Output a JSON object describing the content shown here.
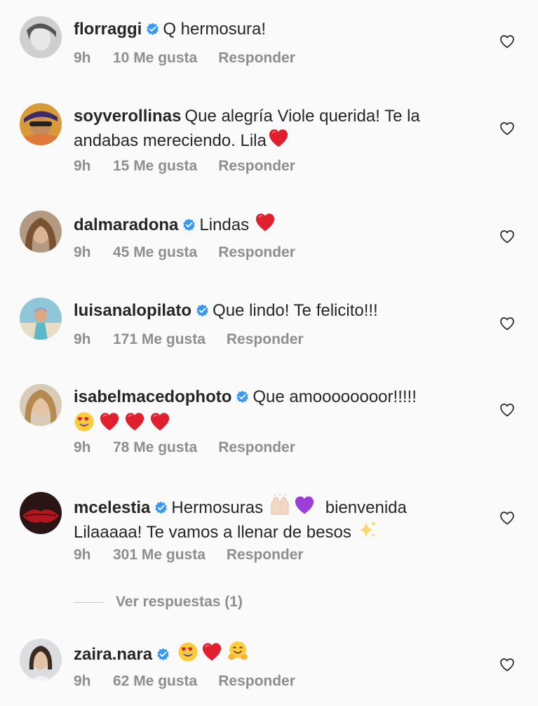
{
  "comments": [
    {
      "username": "florraggi",
      "verified": true,
      "text": "Q hermosura!",
      "emojis": [],
      "time": "9h",
      "likes": "10 Me gusta",
      "reply": "Responder"
    },
    {
      "username": "soyverollinas",
      "verified": false,
      "text": "Que alegría Viole querida! Te la andabas mereciendo. Lila",
      "emojis": [
        "red-heart"
      ],
      "time": "9h",
      "likes": "15 Me gusta",
      "reply": "Responder"
    },
    {
      "username": "dalmaradona",
      "verified": true,
      "text": "Lindas",
      "emojis": [
        "red-heart"
      ],
      "time": "9h",
      "likes": "45 Me gusta",
      "reply": "Responder"
    },
    {
      "username": "luisanalopilato",
      "verified": true,
      "text": "Que lindo! Te felicito!!!",
      "emojis": [],
      "time": "9h",
      "likes": "171 Me gusta",
      "reply": "Responder"
    },
    {
      "username": "isabelmacedophoto",
      "verified": true,
      "text": "Que amoooooooor!!!!!",
      "emojis": [
        "heart-eyes",
        "red-heart",
        "red-heart",
        "red-heart"
      ],
      "time": "9h",
      "likes": "78 Me gusta",
      "reply": "Responder"
    },
    {
      "username": "mcelestia",
      "verified": true,
      "text_parts": [
        "Hermosuras",
        "bienvenida Lilaaaaa! Te vamos a llenar de besos"
      ],
      "emojis": [
        "raising-hands",
        "purple-heart",
        "sparkles"
      ],
      "time": "9h",
      "likes": "301 Me gusta",
      "reply": "Responder"
    },
    {
      "username": "zaira.nara",
      "verified": true,
      "text": "",
      "emojis": [
        "heart-eyes",
        "red-heart",
        "hugging-face"
      ],
      "time": "9h",
      "likes": "62 Me gusta",
      "reply": "Responder"
    }
  ],
  "view_replies": "Ver respuestas (1)",
  "colors": {
    "background": "#fafafa",
    "text": "#262626",
    "secondary": "#8e8e8e",
    "verified_blue": "#3897f0",
    "heart_red": "#e0202f"
  },
  "icons": {
    "like_button": "heart-outline-icon",
    "verified_badge": "verified-badge-icon"
  }
}
